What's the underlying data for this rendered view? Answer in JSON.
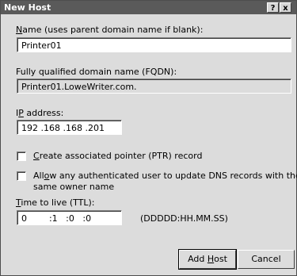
{
  "window": {
    "title": "New Host",
    "help_glyph": "?",
    "close_glyph": "x"
  },
  "name": {
    "label_key": "N",
    "label_rest": "ame (uses parent domain name if blank):",
    "value": "Printer01"
  },
  "fqdn": {
    "label": "Fully qualified domain name (FQDN):",
    "value": "Printer01.LoweWriter.com."
  },
  "ip": {
    "label_a": "I",
    "label_key": "P",
    "label_rest": " address:",
    "value": "192 .168 .168 .201"
  },
  "ptr": {
    "key": "C",
    "rest": "reate associated pointer (PTR) record"
  },
  "allow": {
    "pre": "All",
    "key": "o",
    "rest": "w any authenticated user to update DNS records with the",
    "line2": "same owner name"
  },
  "ttl": {
    "label_key": "T",
    "label_rest": "ime to live (TTL):",
    "value": "0        :1   :0   :0",
    "format": "(DDDDD:HH.MM.SS)"
  },
  "buttons": {
    "add_pre": "Add ",
    "add_key": "H",
    "add_rest": "ost",
    "cancel": "Cancel"
  }
}
